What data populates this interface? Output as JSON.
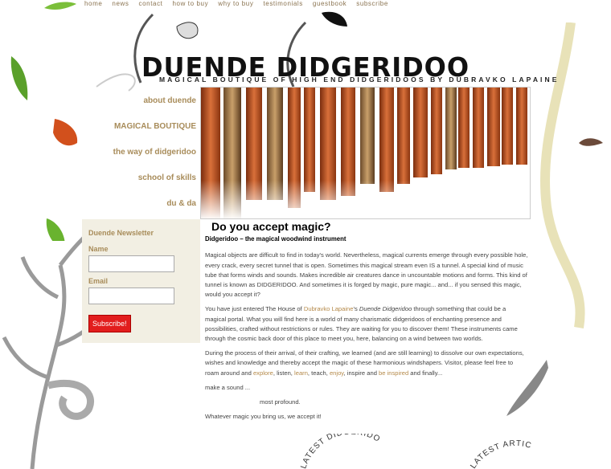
{
  "topnav": [
    "home",
    "news",
    "contact",
    "how to buy",
    "why to buy",
    "testimonials",
    "guestbook",
    "subscribe"
  ],
  "logo": {
    "title": "DUENDE DIDGERIDOO",
    "subtitle": "MAGICAL BOUTIQUE OF HIGH END DIDGERIDOOS BY DUBRAVKO LAPAINE"
  },
  "sidenav": [
    "about duende",
    "MAGICAL BOUTIQUE",
    "the way of didgeridoo",
    "school of skills",
    "du & da"
  ],
  "newsletter": {
    "title": "Duende Newsletter",
    "name_label": "Name",
    "email_label": "Email",
    "button": "Subscribe!"
  },
  "article": {
    "heading": "Do you accept magic?",
    "subheading": "Didgeridoo – the magical woodwind instrument",
    "p1": "Magical objects are difficult to find in today's world. Nevertheless, magical currents emerge through every possible hole, every crack, every secret tunnel that is open. Sometimes this magical stream even IS a tunnel. A special kind of music tube that forms winds and sounds. Makes incredible air creatures dance in uncountable motions and forms. This kind of tunnel is known as DIDGERIDOO. And sometimes it is forged by magic, pure magic... and... if you sensed this magic, would you accept it?",
    "p2_a": "You have just entered The House of ",
    "p2_link": "Dubravko Lapaine",
    "p2_b": "'s ",
    "p2_em": "Duende Didgeridoo",
    "p2_c": " through something that could be a magical portal. What you will find here is a world of many charismatic didgeridoos of enchanting presence and possibilities, crafted without restrictions or rules. They are waiting for you to discover them! These instruments came through the cosmic back door of this place to meet you, here, balancing on a wind between two worlds.",
    "p3_a": "During the process of their arrival, of their crafting, we learned (and are still learning) to dissolve our own expectations, wishes and knowledge and thereby accept the magic of these harmonious windshapers. Visitor, please feel free to roam around and ",
    "p3_l1": "explore",
    "p3_s1": ", listen, ",
    "p3_l2": "learn",
    "p3_s2": ", teach, ",
    "p3_l3": "enjoy",
    "p3_s3": ", inspire and ",
    "p3_l4": "be inspired",
    "p3_s4": " and finally...",
    "p4": "make a sound ...",
    "p5": "most profound.",
    "p6": "Whatever magic you bring us, we accept it!"
  },
  "footer_badges": [
    "LATEST DIDGERIDOOS",
    "LATEST ARTICLES"
  ],
  "colors": {
    "accent": "#a88c5a",
    "button": "#e21d1d",
    "panel": "#f2efe3"
  }
}
